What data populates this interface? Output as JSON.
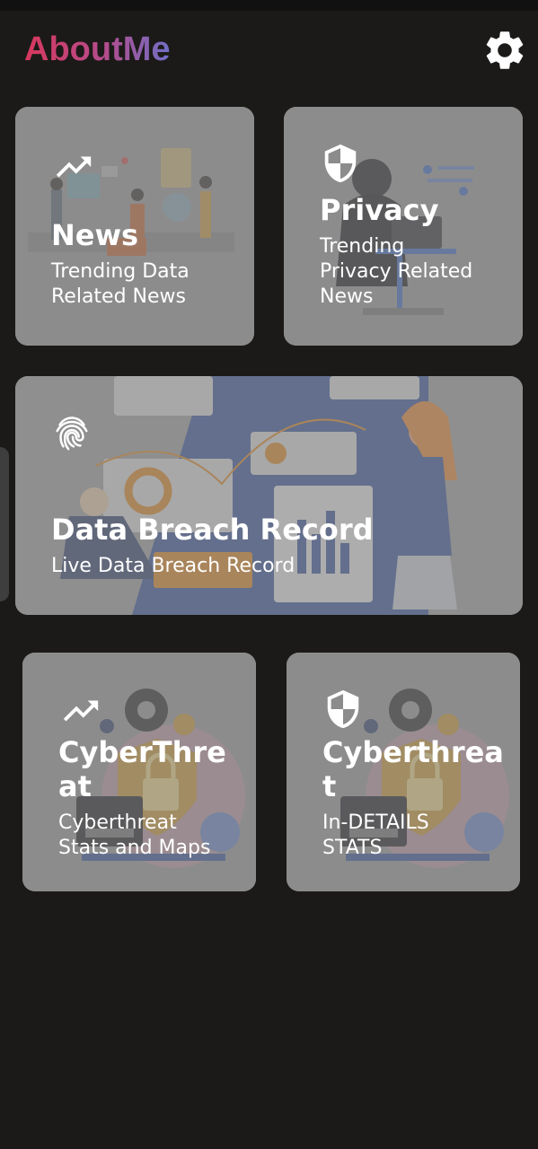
{
  "header": {
    "app_title": "AboutMe",
    "settings_icon": "gear-icon"
  },
  "cards": {
    "news": {
      "icon": "trending-up-icon",
      "title": "News",
      "subtitle_line1": "Trending Data",
      "subtitle_line2": "Related News"
    },
    "privacy": {
      "icon": "shield-icon",
      "title": "Privacy",
      "subtitle_line1": "Trending",
      "subtitle_line2": "Privacy Related",
      "subtitle_line3": "News"
    },
    "breach": {
      "icon": "fingerprint-icon",
      "title": "Data Breach Record",
      "subtitle": "Live Data Breach Record"
    },
    "cyber_maps": {
      "icon": "trending-up-icon",
      "title_line1": "CyberThre",
      "title_line2": "at",
      "subtitle_line1": "Cyberthreat",
      "subtitle_line2": "Stats and Maps"
    },
    "cyber_details": {
      "icon": "shield-icon",
      "title_line1": "Cyberthrea",
      "title_line2": "t",
      "subtitle_line1": "In-DETAILS",
      "subtitle_line2": "STATS"
    }
  },
  "colors": {
    "background": "#1b1a18",
    "title_gradient_start": "#d7385e",
    "title_gradient_end": "#6f6fc7",
    "card_overlay": "#8f8f8f"
  }
}
